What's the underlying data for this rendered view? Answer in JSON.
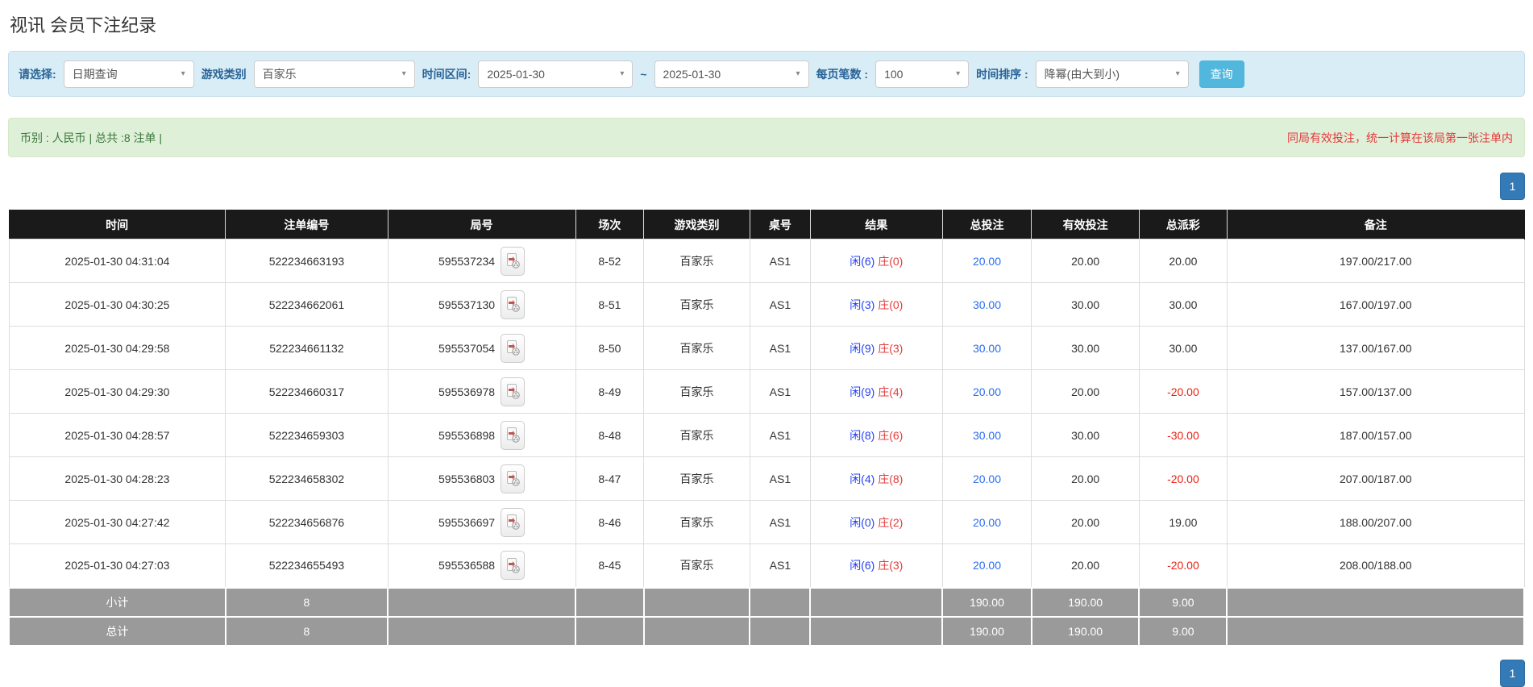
{
  "page_title": "视讯 会员下注纪录",
  "icons": {
    "chevron_down": "▾"
  },
  "filters": {
    "select_label": "请选择:",
    "query_type": "日期查询",
    "game_category_label": "游戏类别",
    "game_category": "百家乐",
    "time_range_label": "时间区间:",
    "date_from": "2025-01-30",
    "range_separator": "~",
    "date_to": "2025-01-30",
    "per_page_label": "每页笔数 :",
    "per_page": "100",
    "sort_label": "时间排序 :",
    "sort_order": "降幂(由大到小)",
    "search_button_label": "查询"
  },
  "info_bar": {
    "summary_text": "币别 : 人民币 | 总共 :8 注单 |",
    "note_text": "同局有效投注，统一计算在该局第一张注单内"
  },
  "pagination": {
    "current_page": "1"
  },
  "table": {
    "headers": [
      "时间",
      "注单编号",
      "局号",
      "场次",
      "游戏类别",
      "桌号",
      "结果",
      "总投注",
      "有效投注",
      "总派彩",
      "备注"
    ],
    "rows": [
      {
        "time": "2025-01-30 04:31:04",
        "bet_no": "522234663193",
        "round_no": "595537234",
        "session": "8-52",
        "game": "百家乐",
        "table_no": "AS1",
        "result_player": "闲(6)",
        "result_banker": "庄(0)",
        "total_bet": "20.00",
        "valid_bet": "20.00",
        "payout": "20.00",
        "remark": "197.00/217.00"
      },
      {
        "time": "2025-01-30 04:30:25",
        "bet_no": "522234662061",
        "round_no": "595537130",
        "session": "8-51",
        "game": "百家乐",
        "table_no": "AS1",
        "result_player": "闲(3)",
        "result_banker": "庄(0)",
        "total_bet": "30.00",
        "valid_bet": "30.00",
        "payout": "30.00",
        "remark": "167.00/197.00"
      },
      {
        "time": "2025-01-30 04:29:58",
        "bet_no": "522234661132",
        "round_no": "595537054",
        "session": "8-50",
        "game": "百家乐",
        "table_no": "AS1",
        "result_player": "闲(9)",
        "result_banker": "庄(3)",
        "total_bet": "30.00",
        "valid_bet": "30.00",
        "payout": "30.00",
        "remark": "137.00/167.00"
      },
      {
        "time": "2025-01-30 04:29:30",
        "bet_no": "522234660317",
        "round_no": "595536978",
        "session": "8-49",
        "game": "百家乐",
        "table_no": "AS1",
        "result_player": "闲(9)",
        "result_banker": "庄(4)",
        "total_bet": "20.00",
        "valid_bet": "20.00",
        "payout": "-20.00",
        "remark": "157.00/137.00"
      },
      {
        "time": "2025-01-30 04:28:57",
        "bet_no": "522234659303",
        "round_no": "595536898",
        "session": "8-48",
        "game": "百家乐",
        "table_no": "AS1",
        "result_player": "闲(8)",
        "result_banker": "庄(6)",
        "total_bet": "30.00",
        "valid_bet": "30.00",
        "payout": "-30.00",
        "remark": "187.00/157.00"
      },
      {
        "time": "2025-01-30 04:28:23",
        "bet_no": "522234658302",
        "round_no": "595536803",
        "session": "8-47",
        "game": "百家乐",
        "table_no": "AS1",
        "result_player": "闲(4)",
        "result_banker": "庄(8)",
        "total_bet": "20.00",
        "valid_bet": "20.00",
        "payout": "-20.00",
        "remark": "207.00/187.00"
      },
      {
        "time": "2025-01-30 04:27:42",
        "bet_no": "522234656876",
        "round_no": "595536697",
        "session": "8-46",
        "game": "百家乐",
        "table_no": "AS1",
        "result_player": "闲(0)",
        "result_banker": "庄(2)",
        "total_bet": "20.00",
        "valid_bet": "20.00",
        "payout": "19.00",
        "remark": "188.00/207.00"
      },
      {
        "time": "2025-01-30 04:27:03",
        "bet_no": "522234655493",
        "round_no": "595536588",
        "session": "8-45",
        "game": "百家乐",
        "table_no": "AS1",
        "result_player": "闲(6)",
        "result_banker": "庄(3)",
        "total_bet": "20.00",
        "valid_bet": "20.00",
        "payout": "-20.00",
        "remark": "208.00/188.00"
      }
    ],
    "subtotal": {
      "label": "小计",
      "count": "8",
      "total_bet": "190.00",
      "valid_bet": "190.00",
      "payout": "9.00"
    },
    "grand_total": {
      "label": "总计",
      "count": "8",
      "total_bet": "190.00",
      "valid_bet": "190.00",
      "payout": "9.00"
    }
  },
  "colors": {
    "accent_blue": "#337ab7",
    "search_button_blue": "#51b7dd",
    "filter_bar_bg": "#d9edf7",
    "filter_label_blue": "#2a6496",
    "info_bar_bg": "#dff0d8",
    "info_text_green": "#3c763d",
    "note_red": "#e4393c",
    "table_header_bg": "#1a1a1a",
    "summary_row_bg": "#9a9a9a",
    "player_blue": "#2442f5",
    "banker_red": "#e43d3d",
    "bet_link_blue": "#2a6df0",
    "negative_red": "#eb2013"
  }
}
